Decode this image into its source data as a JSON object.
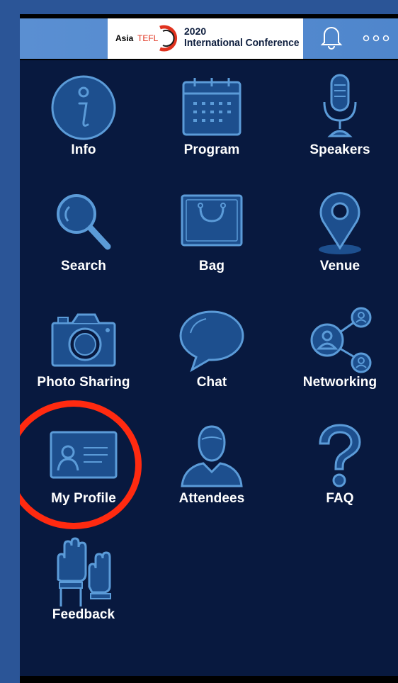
{
  "header": {
    "logo_word_1": "Asia",
    "logo_word_2": "TEFL",
    "year": "2020",
    "title": "International Conference",
    "notification_icon": "bell-icon",
    "menu_icon": "more-icon"
  },
  "menu": [
    {
      "label": "Info",
      "icon": "info-icon"
    },
    {
      "label": "Program",
      "icon": "calendar-icon"
    },
    {
      "label": "Speakers",
      "icon": "microphone-icon"
    },
    {
      "label": "Search",
      "icon": "magnifier-icon"
    },
    {
      "label": "Bag",
      "icon": "bag-icon"
    },
    {
      "label": "Venue",
      "icon": "map-pin-icon"
    },
    {
      "label": "Photo Sharing",
      "icon": "camera-icon"
    },
    {
      "label": "Chat",
      "icon": "speech-bubble-icon"
    },
    {
      "label": "Networking",
      "icon": "network-icon"
    },
    {
      "label": "My Profile",
      "icon": "id-card-icon"
    },
    {
      "label": "Attendees",
      "icon": "person-icon"
    },
    {
      "label": "FAQ",
      "icon": "question-mark-icon"
    },
    {
      "label": "Feedback",
      "icon": "raised-hands-icon"
    }
  ],
  "colors": {
    "background": "#08193f",
    "icon_stroke": "#5b9bd8",
    "icon_fill": "#1d4f8e",
    "highlight": "#ff2a10",
    "header": "#5a8fd2"
  }
}
